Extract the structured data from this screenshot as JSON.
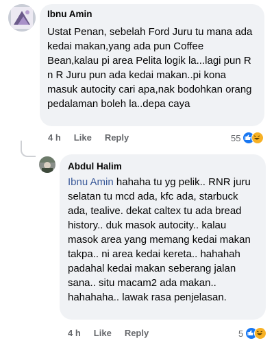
{
  "comments": [
    {
      "author": "Ibnu Amin",
      "text": "Ustat Penan, sebelah Ford Juru tu mana ada kedai makan,yang ada pun Coffee Bean,kalau pi area Pelita logik la...lagi pun R n R Juru pun ada kedai makan..pi kona masuk autocity cari apa,nak bodohkan orang pedalaman boleh la..depa caya",
      "time": "4 h",
      "like_label": "Like",
      "reply_label": "Reply",
      "reaction_count": "55"
    },
    {
      "author": "Abdul Halim",
      "mention": "Ibnu Amin",
      "text": " hahaha tu yg pelik.. RNR juru selatan tu mcd ada, kfc ada, starbuck ada, tealive. dekat caltex tu ada bread history.. duk masok autocity.. kalau masok area yang memang kedai makan takpa.. ni area kedai kereta.. hahahah padahal kedai makan seberang jalan sana.. situ macam2 ada makan.. hahahaha.. lawak rasa penjelasan.",
      "time": "4 h",
      "like_label": "Like",
      "reply_label": "Reply",
      "reaction_count": "5"
    }
  ],
  "reaction_icons": [
    "like-icon",
    "haha-icon"
  ],
  "colors": {
    "bubble": "#f0f2f5",
    "mention": "#385898",
    "meta": "#65676b",
    "like": "#1877f2",
    "haha": "#f7b125"
  }
}
